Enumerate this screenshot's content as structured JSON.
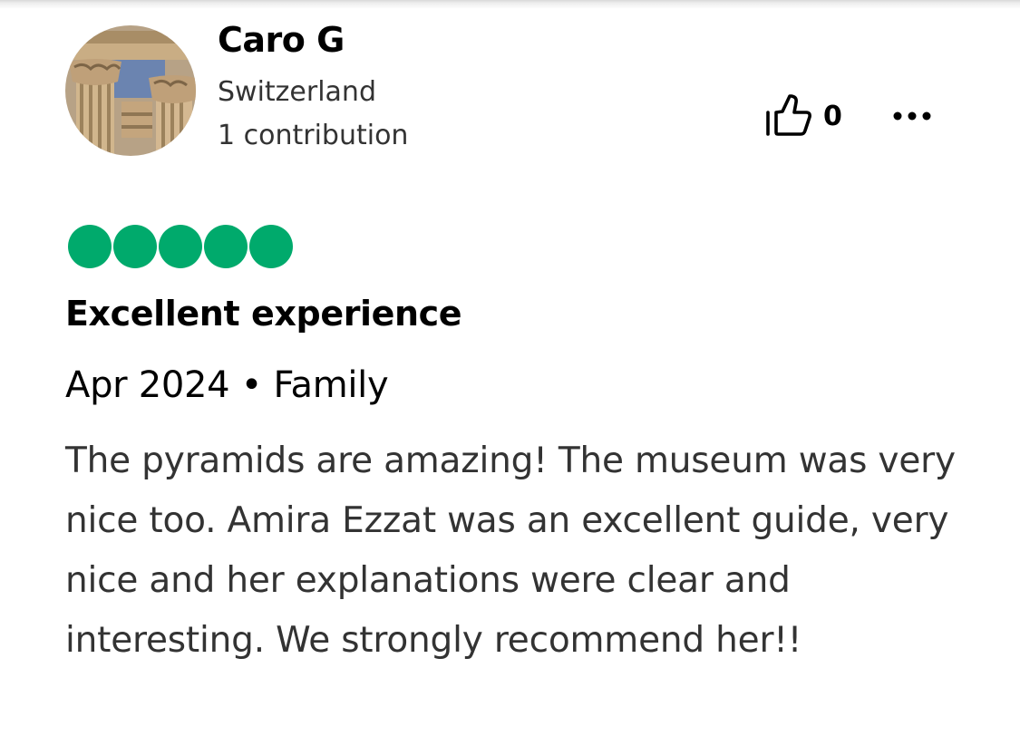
{
  "user": {
    "name": "Caro G",
    "location": "Switzerland",
    "contributions": "1 contribution"
  },
  "actions": {
    "helpful_icon": "thumbs-up-icon",
    "helpful_count": "0",
    "more_icon": "more-horizontal-icon"
  },
  "review": {
    "rating": 5,
    "rating_max": 5,
    "rating_color": "#00aa6c",
    "title": "Excellent experience",
    "date": "Apr 2024",
    "separator": "•",
    "trip_type": "Family",
    "body": "The pyramids are amazing! The museum was very nice too. Amira Ezzat was an excellent guide, very nice and her explanations were clear and interesting. We strongly recommend her!!"
  }
}
